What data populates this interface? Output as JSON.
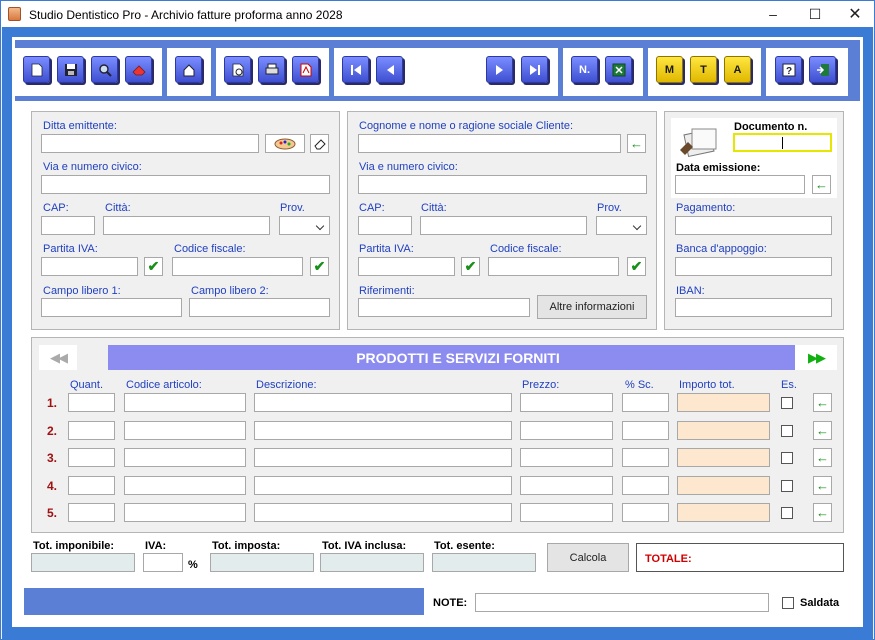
{
  "window": {
    "title": "Studio Dentistico Pro - Archivio fatture proforma anno 2028"
  },
  "toolbar": {
    "nuovo": "",
    "salva": "",
    "cerca": "",
    "stampa_rosso": "",
    "home": "",
    "anteprima": "",
    "stampa": "",
    "pdf": "",
    "primo": "",
    "precedente": "",
    "successivo": "",
    "ultimo": "",
    "numero": "N.",
    "excel": "",
    "m": "M",
    "t": "T",
    "a": "A",
    "help": "",
    "esci": ""
  },
  "emittente": {
    "ditta_label": "Ditta emittente:",
    "via_label": "Via e numero civico:",
    "cap_label": "CAP:",
    "citta_label": "Città:",
    "prov_label": "Prov.",
    "piva_label": "Partita IVA:",
    "cf_label": "Codice fiscale:",
    "libero1_label": "Campo libero 1:",
    "libero2_label": "Campo libero 2:"
  },
  "cliente": {
    "nome_label": "Cognome e nome o ragione sociale Cliente:",
    "via_label": "Via e numero civico:",
    "cap_label": "CAP:",
    "citta_label": "Città:",
    "prov_label": "Prov.",
    "piva_label": "Partita IVA:",
    "cf_label": "Codice fiscale:",
    "rif_label": "Riferimenti:",
    "altre_button": "Altre informazioni"
  },
  "documento": {
    "numero_label": "Documento n.",
    "data_label": "Data emissione:",
    "pagamento_label": "Pagamento:",
    "banca_label": "Banca d'appoggio:",
    "iban_label": "IBAN:"
  },
  "prodotti": {
    "title": "PRODOTTI E SERVIZI FORNITI",
    "headers": {
      "quant": "Quant.",
      "codice": "Codice articolo:",
      "descr": "Descrizione:",
      "prezzo": "Prezzo:",
      "sconto": "% Sc.",
      "importo": "Importo tot.",
      "es": "Es."
    },
    "rows": [
      {
        "n": "1."
      },
      {
        "n": "2."
      },
      {
        "n": "3."
      },
      {
        "n": "4."
      },
      {
        "n": "5."
      }
    ]
  },
  "totali": {
    "imponibile_label": "Tot. imponibile:",
    "iva_label": "IVA:",
    "percent": "%",
    "imposta_label": "Tot. imposta:",
    "ivainclusa_label": "Tot. IVA inclusa:",
    "esente_label": "Tot. esente:",
    "calcola_button": "Calcola",
    "totale_label": "TOTALE:"
  },
  "footer": {
    "note_label": "NOTE:",
    "saldata_label": "Saldata"
  },
  "colors": {
    "frame": "#3a7bd5",
    "toolbar": "#5c7fd6",
    "banner": "#8b8bf0",
    "button": "#3e4fd1",
    "accent_red": "#a01010"
  }
}
